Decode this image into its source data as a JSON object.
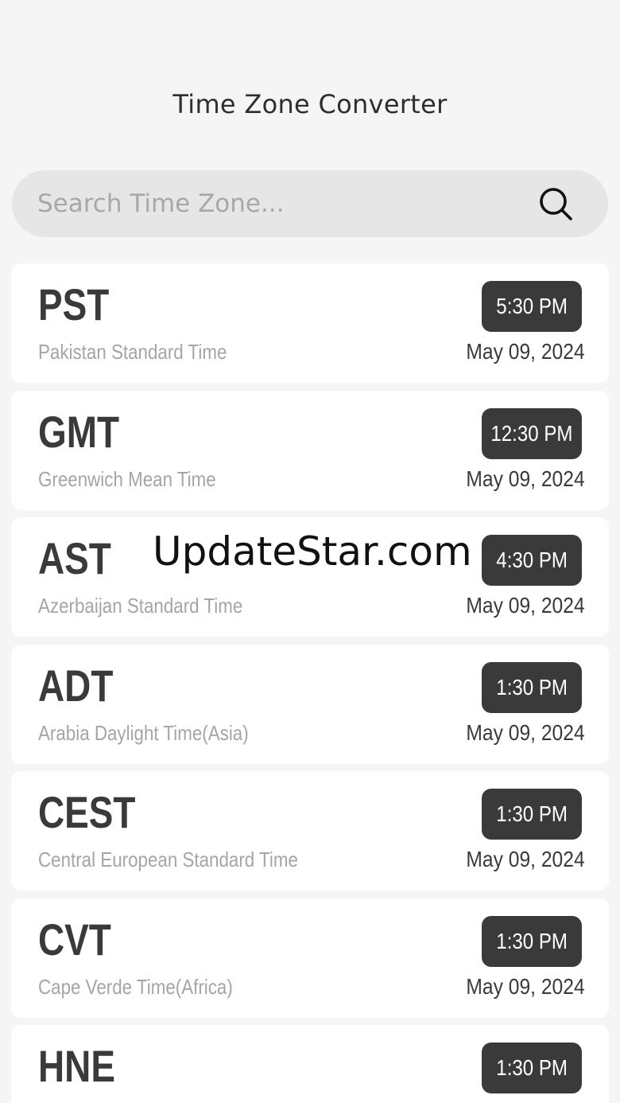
{
  "header": {
    "title": "Time Zone Converter"
  },
  "search": {
    "placeholder": "Search Time Zone...",
    "value": "",
    "icon": "search-icon"
  },
  "zones": [
    {
      "abbr": "PST",
      "name": "Pakistan Standard Time",
      "time": "5:30 PM",
      "date": "May 09, 2024"
    },
    {
      "abbr": "GMT",
      "name": "Greenwich Mean Time",
      "time": "12:30 PM",
      "date": "May 09, 2024"
    },
    {
      "abbr": "AST",
      "name": "Azerbaijan Standard Time",
      "time": "4:30 PM",
      "date": "May 09, 2024"
    },
    {
      "abbr": "ADT",
      "name": "Arabia Daylight Time(Asia)",
      "time": "1:30 PM",
      "date": "May 09, 2024"
    },
    {
      "abbr": "CEST",
      "name": "Central European Standard Time",
      "time": "1:30 PM",
      "date": "May 09, 2024"
    },
    {
      "abbr": "CVT",
      "name": "Cape Verde Time(Africa)",
      "time": "1:30 PM",
      "date": "May 09, 2024"
    },
    {
      "abbr": "HNE",
      "name": "",
      "time": "1:30 PM",
      "date": ""
    }
  ],
  "watermark": "UpdateStar.com",
  "colors": {
    "background": "#f5f5f5",
    "card": "#ffffff",
    "pill": "#3a3a3a",
    "search": "#e6e6e6"
  }
}
